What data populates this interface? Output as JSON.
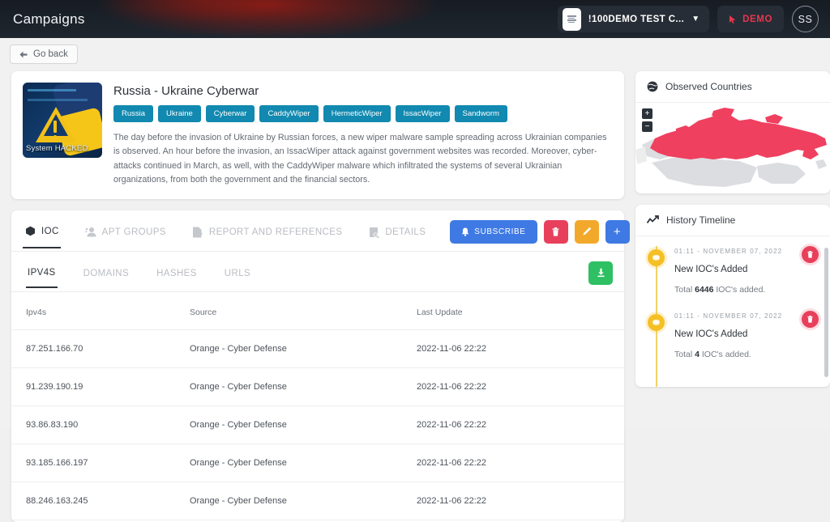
{
  "topbar": {
    "title": "Campaigns",
    "org_logo_icon": "document-logo-icon",
    "org_name": "!100DEMO TEST C...",
    "org_chevron_icon": "chevron-down-icon",
    "demo_cursor_icon": "cursor-click-icon",
    "demo_label": "DEMO",
    "avatar_initials": "SS"
  },
  "nav": {
    "go_back_icon": "arrow-left-icon",
    "go_back_label": "Go back"
  },
  "campaign": {
    "thumbnail_icon": "system-hacked-warning-image",
    "thumbnail_caption": "System HACKED",
    "title": "Russia - Ukraine Cyberwar",
    "tags": [
      "Russia",
      "Ukraine",
      "Cyberwar",
      "CaddyWiper",
      "HermeticWiper",
      "IssacWiper",
      "Sandworm"
    ],
    "description": "The day before the invasion of Ukraine by Russian forces, a new wiper malware sample spreading across Ukrainian companies is observed. An hour before the invasion, an IssacWiper attack against government websites was recorded. Moreover, cyber-attacks continued in March, as well, with the CaddyWiper malware which infiltrated the systems of several Ukrainian organizations, from both the government and the financial sectors."
  },
  "ioc": {
    "tabs": [
      {
        "label": "IOC",
        "icon": "hexagon-icon",
        "active": true
      },
      {
        "label": "APT GROUPS",
        "icon": "users-icon",
        "active": false
      },
      {
        "label": "REPORT AND REFERENCES",
        "icon": "file-check-icon",
        "active": false
      },
      {
        "label": "DETAILS",
        "icon": "file-search-icon",
        "active": false
      }
    ],
    "actions": {
      "subscribe_icon": "bell-icon",
      "subscribe_label": "SUBSCRIBE",
      "delete_icon": "trash-icon",
      "edit_icon": "pencil-icon",
      "add_icon": "plus-icon",
      "add_label": "+"
    },
    "subtabs": [
      {
        "label": "IPV4S",
        "active": true
      },
      {
        "label": "DOMAINS",
        "active": false
      },
      {
        "label": "HASHES",
        "active": false
      },
      {
        "label": "URLS",
        "active": false
      }
    ],
    "download_icon": "download-icon",
    "table": {
      "columns": [
        "Ipv4s",
        "Source",
        "Last Update"
      ],
      "rows": [
        [
          "87.251.166.70",
          "Orange - Cyber Defense",
          "2022-11-06 22:22"
        ],
        [
          "91.239.190.19",
          "Orange - Cyber Defense",
          "2022-11-06 22:22"
        ],
        [
          "93.86.83.190",
          "Orange - Cyber Defense",
          "2022-11-06 22:22"
        ],
        [
          "93.185.166.197",
          "Orange - Cyber Defense",
          "2022-11-06 22:22"
        ],
        [
          "88.246.163.245",
          "Orange - Cyber Defense",
          "2022-11-06 22:22"
        ]
      ]
    }
  },
  "observed_countries": {
    "icon": "globe-icon",
    "title": "Observed Countries",
    "zoom_in_label": "+",
    "zoom_out_label": "−",
    "highlight_color": "#ef4060",
    "base_color": "#dcdde0",
    "highlighted_country": "Russia"
  },
  "history_timeline": {
    "icon": "trend-line-icon",
    "title": "History Timeline",
    "entries": [
      {
        "date": "01:11 - NOVEMBER 07, 2022",
        "title": "New IOC's Added",
        "total": "6446",
        "detail_prefix": "Total ",
        "detail_suffix": " IOC's added.",
        "marker_icon": "coin-icon",
        "delete_icon": "trash-icon"
      },
      {
        "date": "01:11 - NOVEMBER 07, 2022",
        "title": "New IOC's Added",
        "total": "4",
        "detail_prefix": "Total ",
        "detail_suffix": " IOC's added.",
        "marker_icon": "coin-icon",
        "delete_icon": "trash-icon"
      }
    ]
  }
}
